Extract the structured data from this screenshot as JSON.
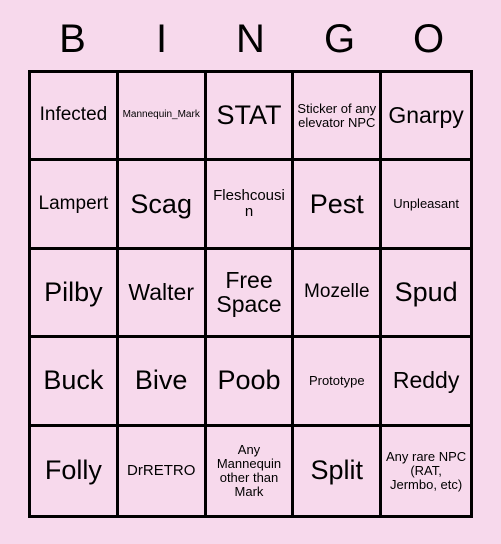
{
  "card": {
    "background_color": "#f7d9ec",
    "border_color": "#000000",
    "text_color": "#000000",
    "header": {
      "letters": [
        "B",
        "I",
        "N",
        "G",
        "O"
      ]
    },
    "grid": {
      "columns": 5,
      "rows": 5,
      "cells": [
        {
          "text": "Infected",
          "size": "md"
        },
        {
          "text": "Mannequin_Mark",
          "size": "xxs"
        },
        {
          "text": "STAT",
          "size": "xl"
        },
        {
          "text": "Sticker of any elevator NPC",
          "size": "xs"
        },
        {
          "text": "Gnarpy",
          "size": "lg"
        },
        {
          "text": "Lampert",
          "size": "md"
        },
        {
          "text": "Scag",
          "size": "xl"
        },
        {
          "text": "Fleshcousin",
          "size": "sm"
        },
        {
          "text": "Pest",
          "size": "xl"
        },
        {
          "text": "Unpleasant",
          "size": "xs"
        },
        {
          "text": "Pilby",
          "size": "xl"
        },
        {
          "text": "Walter",
          "size": "lg"
        },
        {
          "text": "Free Space",
          "size": "free"
        },
        {
          "text": "Mozelle",
          "size": "md"
        },
        {
          "text": "Spud",
          "size": "xl"
        },
        {
          "text": "Buck",
          "size": "xl"
        },
        {
          "text": "Bive",
          "size": "xl"
        },
        {
          "text": "Poob",
          "size": "xl"
        },
        {
          "text": "Prototype",
          "size": "xs"
        },
        {
          "text": "Reddy",
          "size": "lg"
        },
        {
          "text": "Folly",
          "size": "xl"
        },
        {
          "text": "DrRETRO",
          "size": "sm"
        },
        {
          "text": "Any Mannequin other than Mark",
          "size": "xs"
        },
        {
          "text": "Split",
          "size": "xl"
        },
        {
          "text": "Any rare NPC (RAT, Jermbo, etc)",
          "size": "xs"
        }
      ]
    }
  }
}
